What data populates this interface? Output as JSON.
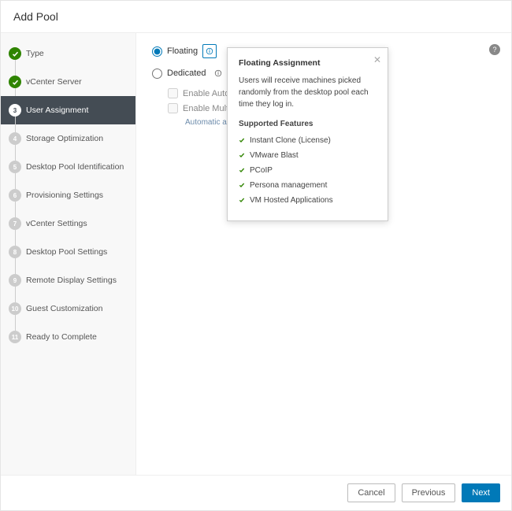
{
  "header": {
    "title": "Add Pool"
  },
  "sidebar": {
    "steps": [
      {
        "label": "Type",
        "state": "done"
      },
      {
        "label": "vCenter Server",
        "state": "done"
      },
      {
        "label": "User Assignment",
        "state": "active",
        "num": "3"
      },
      {
        "label": "Storage Optimization",
        "state": "pending",
        "num": "4"
      },
      {
        "label": "Desktop Pool Identification",
        "state": "pending",
        "num": "5"
      },
      {
        "label": "Provisioning Settings",
        "state": "pending",
        "num": "6"
      },
      {
        "label": "vCenter Settings",
        "state": "pending",
        "num": "7"
      },
      {
        "label": "Desktop Pool Settings",
        "state": "pending",
        "num": "8"
      },
      {
        "label": "Remote Display Settings",
        "state": "pending",
        "num": "9"
      },
      {
        "label": "Guest Customization",
        "state": "pending",
        "num": "10"
      },
      {
        "label": "Ready to Complete",
        "state": "pending",
        "num": "11"
      }
    ]
  },
  "form": {
    "options": {
      "floating": {
        "label": "Floating",
        "selected": true
      },
      "dedicated": {
        "label": "Dedicated",
        "selected": false
      }
    },
    "sub": {
      "enable_auto": "Enable Auto",
      "enable_multi": "Enable Multi",
      "auto_note": "Automatic as"
    }
  },
  "tooltip": {
    "title": "Floating Assignment",
    "body": "Users will receive machines picked randomly from the desktop pool each time they log in.",
    "features_heading": "Supported Features",
    "features": [
      "Instant Clone (License)",
      "VMware Blast",
      "PCoIP",
      "Persona management",
      "VM Hosted Applications"
    ]
  },
  "footer": {
    "cancel": "Cancel",
    "previous": "Previous",
    "next": "Next"
  },
  "icons": {
    "help": "?"
  }
}
